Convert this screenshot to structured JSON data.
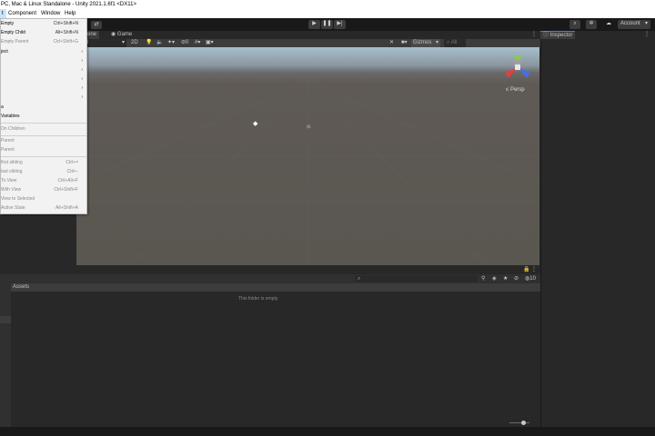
{
  "window": {
    "title": "PC, Mac & Linux Standalone - Unity 2021.1.6f1 <DX11>"
  },
  "menubar": {
    "items": [
      "t",
      "Component",
      "Window",
      "Help"
    ]
  },
  "toolbar": {
    "account_label": "Account"
  },
  "scene_view": {
    "tabs": [
      "Scene",
      "Game"
    ],
    "shading_mode": "ded",
    "mode_2d": "2D",
    "gizmos_label": "Gizmos",
    "all_label": "All",
    "persp_label": "Persp",
    "gizmo_axes": {
      "y": "y",
      "x": "x",
      "z": "z"
    }
  },
  "inspector": {
    "tab_label": "Inspector"
  },
  "project": {
    "assets_label": "Assets",
    "empty_message": "This folder is empty",
    "hidden_count": "10"
  },
  "context_menu": {
    "items": [
      {
        "label": "Empty",
        "shortcut": "Ctrl+Shift+N",
        "disabled": false
      },
      {
        "label": "Empty Child",
        "shortcut": "Alt+Shift+N",
        "disabled": false
      },
      {
        "label": "Empty Parent",
        "shortcut": "Ctrl+Shift+G",
        "disabled": true
      },
      {
        "label": "ject",
        "submenu": true
      },
      {
        "label": "",
        "submenu": true
      },
      {
        "label": "",
        "submenu": true
      },
      {
        "label": "",
        "submenu": true
      },
      {
        "label": "",
        "submenu": true
      },
      {
        "label": "",
        "submenu": true
      },
      {
        "label": "a"
      },
      {
        "label": "Variables"
      },
      {
        "label": "On Children",
        "disabled": true
      },
      {
        "label": "Parent",
        "disabled": true
      },
      {
        "label": "Parent",
        "disabled": true
      },
      {
        "label": "first sibling",
        "shortcut": "Ctrl+=",
        "disabled": true
      },
      {
        "label": "last sibling",
        "shortcut": "Ctrl+-",
        "disabled": true
      },
      {
        "label": "To View",
        "shortcut": "Ctrl+Alt+F",
        "disabled": true
      },
      {
        "label": "With View",
        "shortcut": "Ctrl+Shift+F",
        "disabled": true
      },
      {
        "label": "View to Selected",
        "disabled": true
      },
      {
        "label": "Active State",
        "shortcut": "Alt+Shift+A",
        "disabled": true
      }
    ]
  },
  "colors": {
    "accent": "#4a7cd8",
    "toolbar": "#191919",
    "panel": "#282828",
    "menu": "#f2f2f2"
  }
}
